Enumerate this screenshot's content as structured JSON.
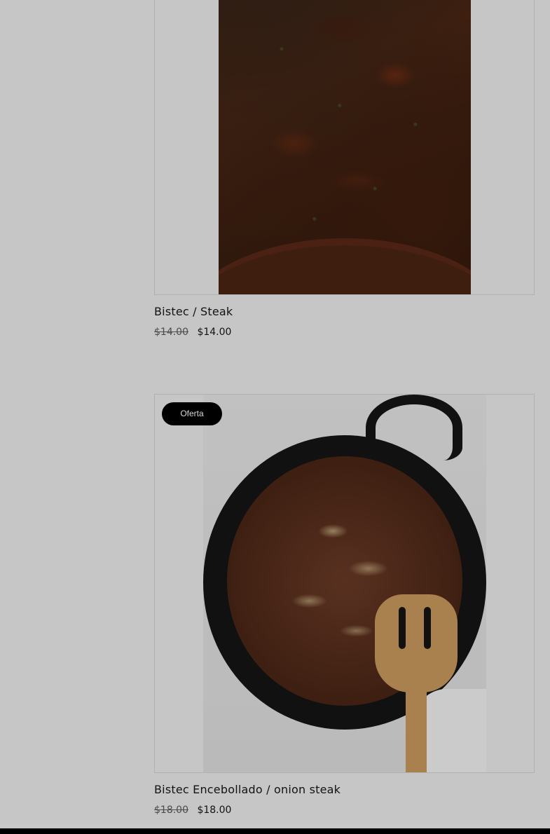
{
  "products": [
    {
      "name": "Bistec / Steak",
      "price_old": "$14.00",
      "price_new": "$14.00",
      "badge": ""
    },
    {
      "name": "Bistec Encebollado / onion steak",
      "price_old": "$18.00",
      "price_new": "$18.00",
      "badge": "Oferta"
    }
  ],
  "colors": {
    "badge_background": "#000000",
    "badge_text": "#ffffff",
    "price_strike": "#5b5b5b"
  }
}
